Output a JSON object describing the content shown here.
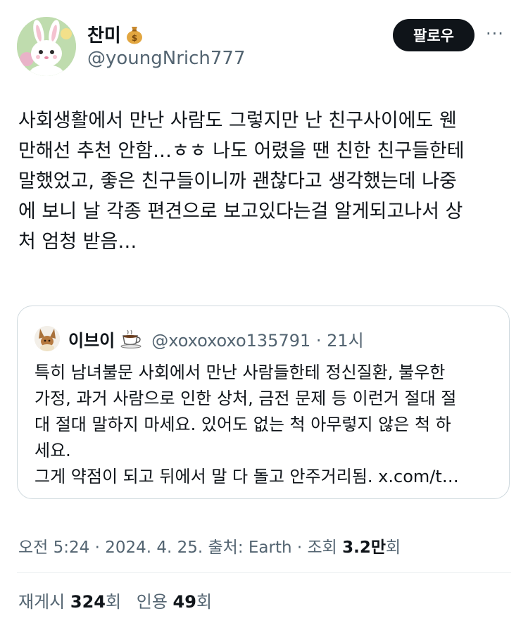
{
  "author": {
    "name": "찬미",
    "name_emoji": "money-bag-icon",
    "handle": "@youngNrich777"
  },
  "follow_label": "팔로우",
  "more_label": "···",
  "tweet_lines": [
    "사회생활에서 만난 사람도 그렇지만 난 친구사이에도 웬",
    "만해선 추천 안함…ㅎㅎ 나도 어렸을 땐 친한 친구들한테",
    "말했었고, 좋은 친구들이니까 괜찮다고 생각했는데 나중",
    "에 보니 날 각종 편견으로 보고있다는걸 알게되고나서 상",
    "처 엄청 받음…"
  ],
  "quote": {
    "name": "이브이",
    "name_emoji": "coffee-icon",
    "handle_time": "@xoxoxoxo135791 · 21시",
    "lines": [
      "특히 남녀불문 사회에서 만난 사람들한테 정신질환, 불우한",
      "가정, 과거 사람으로 인한 상처, 금전 문제 등 이런거 절대 절",
      "대 절대 말하지 마세요. 있어도 없는 척 아무렇지 않은 척 하",
      "세요.",
      "그게 약점이 되고 뒤에서 말 다 돌고 안주거리됨. x.com/t…"
    ]
  },
  "timeline": {
    "text": "오전 5:24 · 2024. 4. 25. 출처: Earth · 조회 ",
    "views": "3.2만",
    "views_suffix": "회"
  },
  "stats": {
    "retweets_label": "재게시",
    "retweets": "324",
    "retweets_suffix": "회",
    "quotes_label": "인용",
    "quotes": "49",
    "quotes_suffix": "회"
  }
}
